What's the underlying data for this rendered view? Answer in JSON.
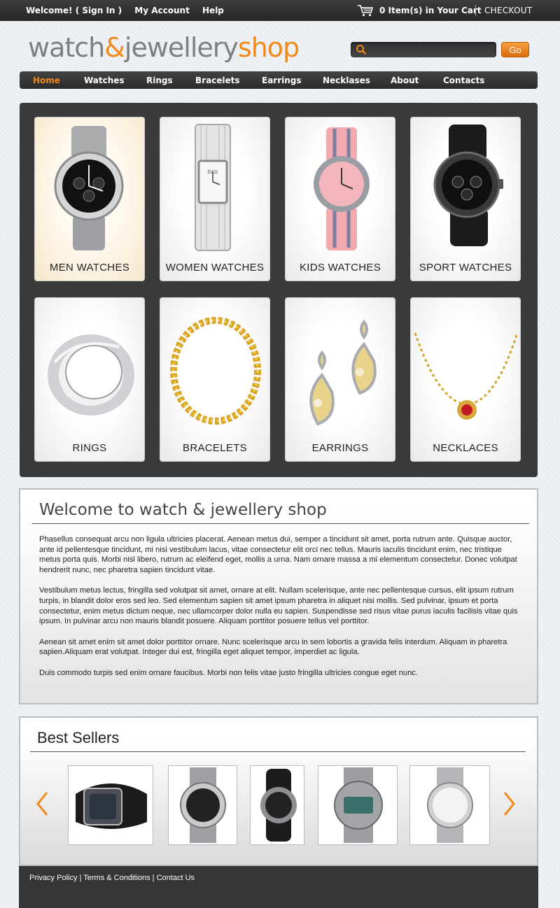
{
  "topbar": {
    "welcome": "Welcome! ( Sign In )",
    "account": "My Account",
    "help": "Help",
    "cart_text": "0 Item(s) in Your Cart",
    "checkout": "CHECKOUT"
  },
  "logo": {
    "part1": "watch",
    "amp": "&",
    "part2": "jewellery",
    "part3": "shop"
  },
  "search": {
    "value": "",
    "button": "Go"
  },
  "nav": [
    {
      "label": "Home",
      "active": true
    },
    {
      "label": "Watches"
    },
    {
      "label": "Rings"
    },
    {
      "label": "Bracelets"
    },
    {
      "label": "Earrings"
    },
    {
      "label": "Necklases"
    },
    {
      "label": "About"
    },
    {
      "label": "Contacts"
    }
  ],
  "categories": [
    {
      "label": "MEN WATCHES"
    },
    {
      "label": "WOMEN WATCHES"
    },
    {
      "label": "KIDS WATCHES"
    },
    {
      "label": "SPORT WATCHES"
    },
    {
      "label": "RINGS"
    },
    {
      "label": "BRACELETS"
    },
    {
      "label": "EARRINGS"
    },
    {
      "label": "NECKLACES"
    }
  ],
  "welcome": {
    "title": "Welcome to watch & jewellery shop",
    "paragraphs": [
      "Phasellus consequat arcu non ligula ultricies placerat. Aenean metus dui, semper a tincidunt sit amet, porta rutrum ante. Quisque auctor, ante id pellentesque tincidunt, mi nisi vestibulum lacus, vitae consectetur elit orci nec tellus. Mauris iaculis tincidunt enim, nec tristique metus porta quis. Morbi nisl libero, rutrum ac eleifend eget, mollis a urna. Nam ornare massa a mi elementum consectetur. Donec volutpat hendrerit nunc, nec pharetra sapien tincidunt vitae.",
      "Vestibulum metus lectus, fringilla sed volutpat sit amet, ornare at elit. Nullam scelerisque, ante nec pellentesque cursus, elit ipsum rutrum turpis, in blandit dolor eros sed leo. Sed elementum sapien sit amet ipsum pharetra in aliquet nisi mollis. Sed pulvinar, ipsum et porta consectetur, enim metus dictum neque, nec ullamcorper dolor nulla eu sapien. Suspendisse sed risus vitae purus iaculis facilisis vitae quis ipsum. In pulvinar arcu non mauris blandit posuere. Aliquam porttitor posuere tellus vel porttitor.",
      "Aenean sit amet enim sit amet dolor porttitor ornare. Nunc scelerisque arcu in sem lobortis a gravida felis interdum. Aliquam in pharetra sapien.Aliquam erat volutpat. Integer dui est, fringilla eget aliquet tempor, imperdiet ac ligula.",
      "Duis commodo turpis sed enim ornare faucibus. Morbi non felis vitae justo fringilla ultricies congue eget nunc."
    ]
  },
  "best_sellers": {
    "title": "Best Sellers",
    "prev_icon": "chevron-left-icon",
    "next_icon": "chevron-right-icon"
  },
  "footer": {
    "privacy": "Privacy Policy",
    "terms": "Terms & Conditions",
    "contact": "Contact Us"
  },
  "colors": {
    "accent": "#f08a1c",
    "dark": "#353535",
    "logo_gray": "#7c8080"
  }
}
